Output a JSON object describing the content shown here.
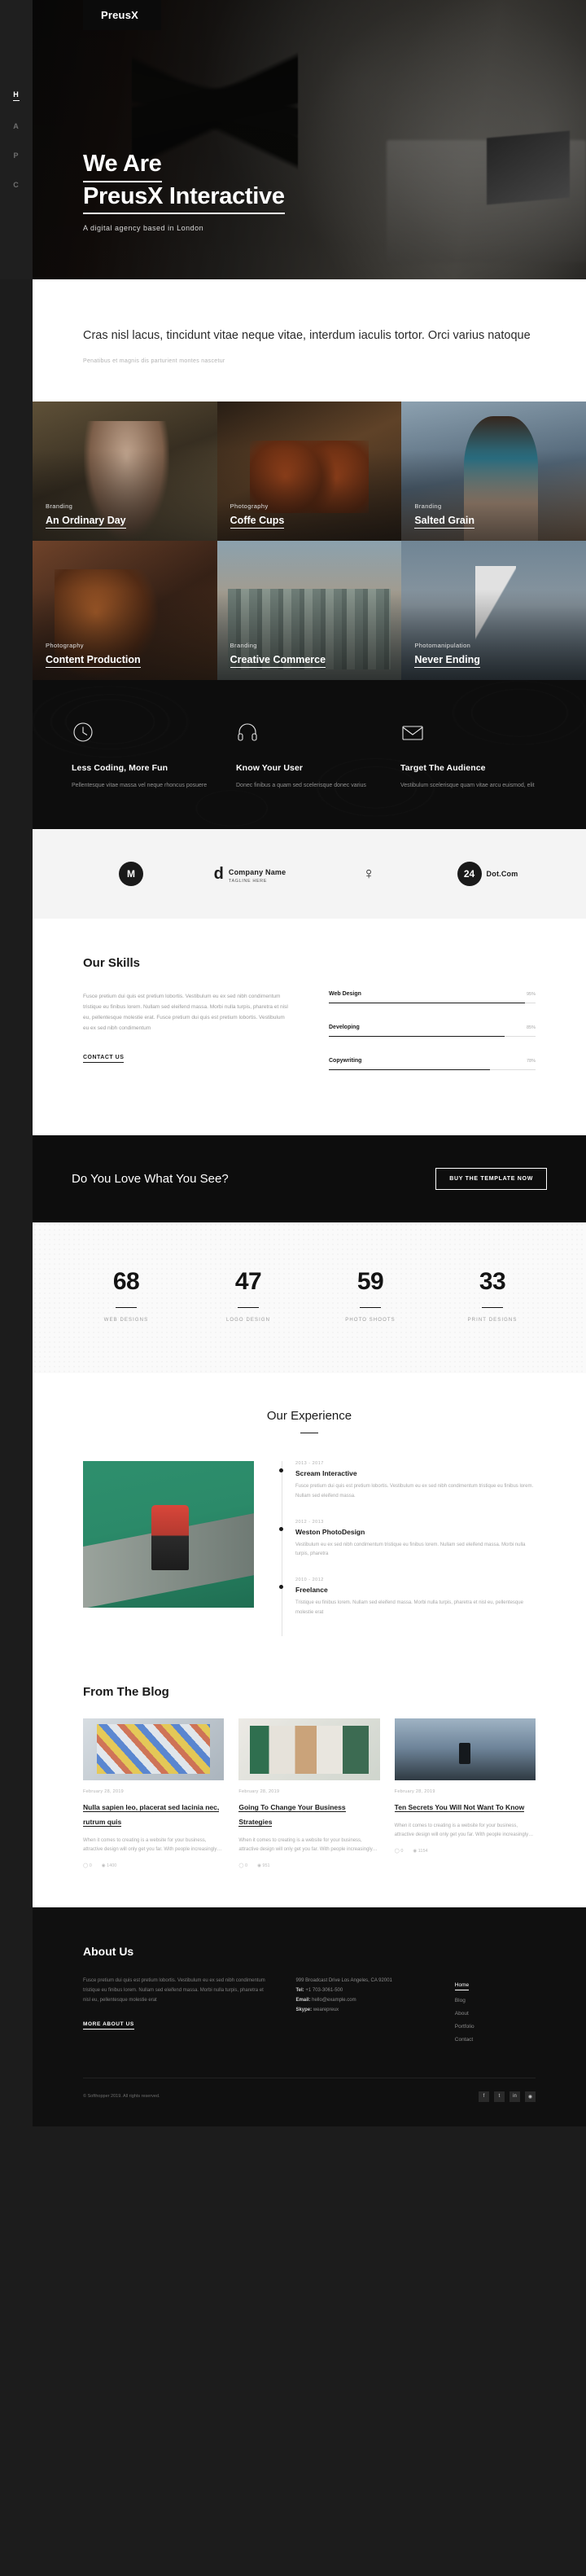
{
  "sidenav": {
    "items": [
      {
        "letter": "H",
        "name": "home",
        "active": true
      },
      {
        "letter": "A",
        "name": "about",
        "active": false
      },
      {
        "letter": "P",
        "name": "portfolio",
        "active": false
      },
      {
        "letter": "C",
        "name": "contact",
        "active": false
      }
    ]
  },
  "hero": {
    "brand": "PreusX",
    "line1": "We Are",
    "line2": "PreusX Interactive",
    "subtitle": "A digital agency based in London"
  },
  "intro": {
    "lead": "Cras nisl lacus, tincidunt vitae neque vitae, interdum iaculis tortor. Orci varius natoque",
    "sub": "Penatibus et magnis dis parturient montes nascetur"
  },
  "portfolio": {
    "items": [
      {
        "category": "Branding",
        "title": "An Ordinary Day"
      },
      {
        "category": "Photography",
        "title": "Coffe Cups"
      },
      {
        "category": "Branding",
        "title": "Salted Grain"
      },
      {
        "category": "Photography",
        "title": "Content Production"
      },
      {
        "category": "Branding",
        "title": "Creative Commerce"
      },
      {
        "category": "Photomanipulation",
        "title": "Never Ending"
      }
    ]
  },
  "features": {
    "items": [
      {
        "icon": "clock-icon",
        "title": "Less Coding, More Fun",
        "text": "Pellentesque vitae massa vel neque rhoncus posuere"
      },
      {
        "icon": "headphone-icon",
        "title": "Know Your User",
        "text": "Donec finibus a quam sed scelerisque donec varius"
      },
      {
        "icon": "envelope-icon",
        "title": "Target The Audience",
        "text": "Vestibulum scelerisque quam vitae arcu euismod, elit"
      }
    ]
  },
  "clients": {
    "items": [
      {
        "mark": "M",
        "name": "",
        "sub": "",
        "type": "circle"
      },
      {
        "mark": "d",
        "name": "Company Name",
        "sub": "TAGLINE HERE",
        "type": "wordmark"
      },
      {
        "mark": "♀",
        "name": "",
        "sub": "",
        "type": "glyph"
      },
      {
        "mark": "24",
        "name": "Dot.Com",
        "sub": "",
        "type": "badge"
      }
    ]
  },
  "skills": {
    "title": "Our Skills",
    "paragraph": "Fusce pretium dui quis est pretium lobortis. Vestibulum eu ex sed nibh condimentum tristique eu finibus lorem. Nullam sed eleifend massa. Morbi nulla turpis, pharetra et nisl eu, pellentesque molestie erat. Fusce pretium dui quis est pretium lobortis. Vestibulum eu ex sed nibh condimentum",
    "contact_label": "CONTACT US",
    "bars": [
      {
        "name": "Web Design",
        "percent": "95%",
        "value": 95
      },
      {
        "name": "Developing",
        "percent": "85%",
        "value": 85
      },
      {
        "name": "Copywriting",
        "percent": "78%",
        "value": 78
      }
    ]
  },
  "cta": {
    "heading": "Do You Love What You See?",
    "button": "BUY THE TEMPLATE NOW"
  },
  "stats": {
    "items": [
      {
        "number": "68",
        "label": "WEB DESIGNS"
      },
      {
        "number": "47",
        "label": "LOGO DESIGN"
      },
      {
        "number": "59",
        "label": "PHOTO SHOOTS"
      },
      {
        "number": "33",
        "label": "PRINT DESIGNS"
      }
    ]
  },
  "experience": {
    "title": "Our Experience",
    "items": [
      {
        "years": "2013 - 2017",
        "role": "Scream Interactive",
        "text": "Fusce pretium dui quis est pretium lobortis. Vestibulum eu ex sed nibh condimentum tristique eu finibus lorem. Nullam sed eleifend massa."
      },
      {
        "years": "2012 - 2013",
        "role": "Weston PhotoDesign",
        "text": "Vestibulum eu ex sed nibh condimentum tristique eu finibus lorem. Nullam sed eleifend massa. Morbi nulla turpis, pharetra"
      },
      {
        "years": "2010 - 2012",
        "role": "Freelance",
        "text": "Tristique eu finibus lorem. Nullam sed eleifend massa. Morbi nulla turpis, pharetra et nisl eu, pellentesque molestie erat"
      }
    ]
  },
  "blog": {
    "title": "From The Blog",
    "posts": [
      {
        "date": "February 28, 2019",
        "title": "Nulla sapien leo, placerat sed lacinia nec, rutrum quis",
        "excerpt": "When it comes to creating is a website for your business, attractive design will only get you far. With people increasingly…",
        "comments": "0",
        "views": "1400"
      },
      {
        "date": "February 28, 2019",
        "title": "Going To Change Your Business Strategies",
        "excerpt": "When it comes to creating is a website for your business, attractive design will only get you far. With people increasingly…",
        "comments": "0",
        "views": "951"
      },
      {
        "date": "February 28, 2019",
        "title": "Ten Secrets You Will Not Want To Know",
        "excerpt": "When it comes to creating is a website for your business, attractive design will only get you far. With people increasingly…",
        "comments": "0",
        "views": "1154"
      }
    ]
  },
  "footer": {
    "title": "About Us",
    "about": "Fusce pretium dui quis est pretium lobortis. Vestibulum eu ex sed nibh condimentum tristique eu finibus lorem. Nullam sed eleifend massa. Morbi nulla turpis, pharetra et nisl eu, pellentesque molestie erat",
    "more_label": "MORE ABOUT US",
    "address": "999 Broadcast Drive Los Angeles, CA 92001",
    "tel_label": "Tel:",
    "tel": "+1 703-3061-500",
    "email_label": "Email:",
    "email": "hello@example.com",
    "skype_label": "Skype:",
    "skype": "wearepreux",
    "links": [
      {
        "label": "Home",
        "active": true
      },
      {
        "label": "Blog",
        "active": false
      },
      {
        "label": "About",
        "active": false
      },
      {
        "label": "Portfolio",
        "active": false
      },
      {
        "label": "Contact",
        "active": false
      }
    ],
    "copyright": "© Softhopper 2019. All rights reserved.",
    "socials": [
      "f",
      "t",
      "in",
      "◉"
    ]
  }
}
